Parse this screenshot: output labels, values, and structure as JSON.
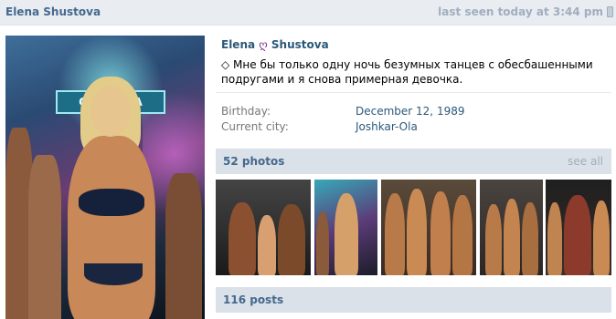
{
  "header": {
    "name": "Elena Shustova",
    "last_seen": "last seen today at 3:44 pm",
    "device_icon": "phone-icon"
  },
  "profile": {
    "first_name": "Elena",
    "middle_symbol": "ღ",
    "last_name": "Shustova",
    "status": "◇ Мне бы только одну ночь безумных танцев с обесбашенными подругами и я снова примерная девочка.",
    "avatar_sign": "СПОР ОТА"
  },
  "info": [
    {
      "label": "Birthday:",
      "value": "December 12, 1989"
    },
    {
      "label": "Current city:",
      "value": "Joshkar-Ola"
    }
  ],
  "photos_section": {
    "title": "52 photos",
    "action": "see all"
  },
  "posts_section": {
    "title": "116 posts"
  }
}
